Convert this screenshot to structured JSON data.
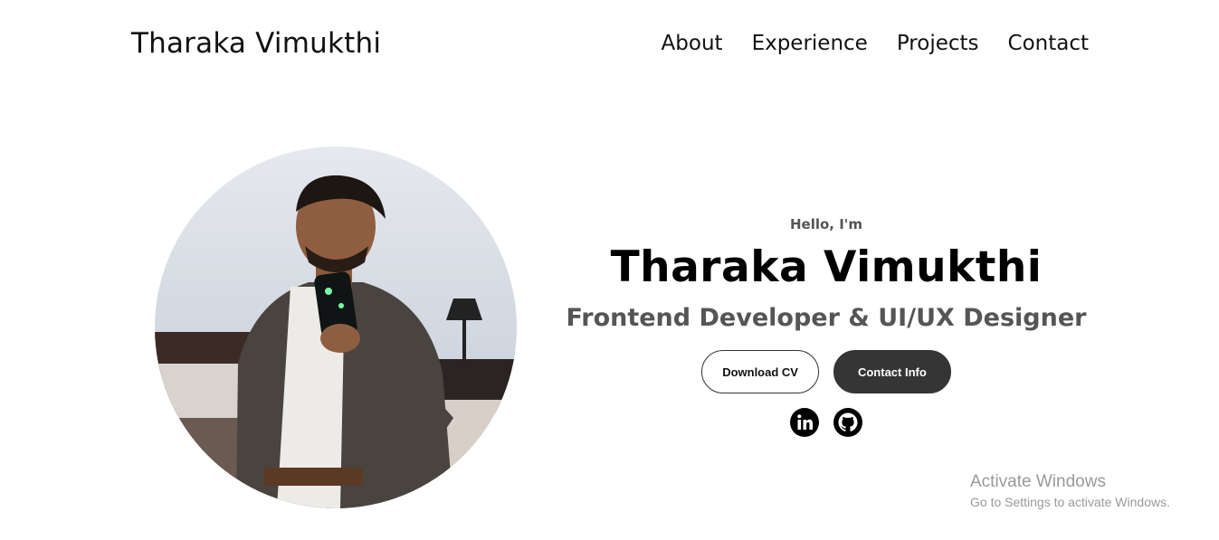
{
  "header": {
    "logo": "Tharaka Vimukthi",
    "nav": [
      {
        "label": "About"
      },
      {
        "label": "Experience"
      },
      {
        "label": "Projects"
      },
      {
        "label": "Contact"
      }
    ]
  },
  "hero": {
    "greeting": "Hello, I'm",
    "name": "Tharaka Vimukthi",
    "title": "Frontend Developer & UI/UX Designer",
    "buttons": {
      "download_cv": "Download CV",
      "contact_info": "Contact Info"
    },
    "socials": [
      {
        "icon": "linkedin-icon"
      },
      {
        "icon": "github-icon"
      }
    ]
  },
  "watermark": {
    "title": "Activate Windows",
    "subtitle": "Go to Settings to activate Windows."
  }
}
